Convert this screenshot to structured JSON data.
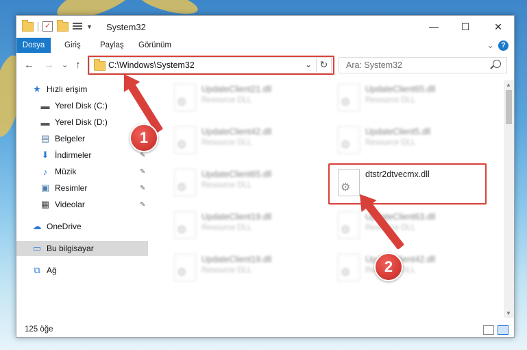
{
  "window": {
    "title": "System32",
    "controls": {
      "minimize": "—",
      "maximize": "☐",
      "close": "✕"
    }
  },
  "ribbon": {
    "tabs": [
      "Dosya",
      "Giriş",
      "Paylaş",
      "Görünüm"
    ],
    "expand_glyph": "⌄",
    "help_label": "?"
  },
  "nav": {
    "back": "←",
    "forward": "→",
    "recent": "⌄",
    "up": "↑",
    "address": "C:\\Windows\\System32",
    "address_dropdown": "⌄",
    "refresh": "↻",
    "search_placeholder": "Ara: System32"
  },
  "sidebar": {
    "items": [
      {
        "label": "Hızlı erişim",
        "icon": "star-icon",
        "glyph": "★",
        "color": "#2a7bd6",
        "pinned": false
      },
      {
        "label": "Yerel Disk (C:)",
        "icon": "drive-icon",
        "glyph": "▬",
        "color": "#555555",
        "pinned": true
      },
      {
        "label": "Yerel Disk (D:)",
        "icon": "drive-icon",
        "glyph": "▬",
        "color": "#555555",
        "pinned": false
      },
      {
        "label": "Belgeler",
        "icon": "document-icon",
        "glyph": "▤",
        "color": "#5b7ea6",
        "pinned": true
      },
      {
        "label": "İndirmeler",
        "icon": "download-icon",
        "glyph": "⬇",
        "color": "#2a7bd6",
        "pinned": true
      },
      {
        "label": "Müzik",
        "icon": "music-icon",
        "glyph": "♪",
        "color": "#2a7bd6",
        "pinned": true
      },
      {
        "label": "Resimler",
        "icon": "picture-icon",
        "glyph": "▣",
        "color": "#4f7fb0",
        "pinned": true
      },
      {
        "label": "Videolar",
        "icon": "video-icon",
        "glyph": "▦",
        "color": "#444444",
        "pinned": true
      },
      {
        "label": "OneDrive",
        "icon": "cloud-icon",
        "glyph": "☁",
        "color": "#2a7bd6",
        "pinned": false
      },
      {
        "label": "Bu bilgisayar",
        "icon": "computer-icon",
        "glyph": "▭",
        "color": "#2a7bd6",
        "pinned": false,
        "selected": true
      },
      {
        "label": "Ağ",
        "icon": "network-icon",
        "glyph": "⧉",
        "color": "#2a7bd6",
        "pinned": false
      }
    ],
    "pin_glyph": "📌"
  },
  "files": [
    {
      "name": "UpdateClient21.dll",
      "type": "Resource DLL",
      "col": 0,
      "row": 0,
      "blurred": true
    },
    {
      "name": "UpdateClient65.dll",
      "type": "Resource DLL",
      "col": 1,
      "row": 0,
      "blurred": true
    },
    {
      "name": "UpdateClient42.dll",
      "type": "Resource DLL",
      "col": 0,
      "row": 1,
      "blurred": true
    },
    {
      "name": "UpdateClient5.dll",
      "type": "Resource DLL",
      "col": 1,
      "row": 1,
      "blurred": true
    },
    {
      "name": "UpdateClient65.dll",
      "type": "Resource DLL",
      "col": 0,
      "row": 2,
      "blurred": true
    },
    {
      "name": "dtstr2dtvecmx.dll",
      "type": "",
      "col": 1,
      "row": 2,
      "blurred": false
    },
    {
      "name": "UpdateClient19.dll",
      "type": "Resource DLL",
      "col": 0,
      "row": 3,
      "blurred": true
    },
    {
      "name": "UpdateClient63.dll",
      "type": "Resource DLL",
      "col": 1,
      "row": 3,
      "blurred": true
    },
    {
      "name": "UpdateClient19.dll",
      "type": "Resource DLL",
      "col": 0,
      "row": 4,
      "blurred": true
    },
    {
      "name": "UpdateClient42.dll",
      "type": "Resource DLL",
      "col": 1,
      "row": 4,
      "blurred": true
    }
  ],
  "status": {
    "count": "125 öğe"
  },
  "annotations": [
    {
      "number": "1",
      "target": "address-bar"
    },
    {
      "number": "2",
      "target": "dll-file"
    }
  ],
  "colors": {
    "accent": "#1979ca",
    "highlight": "#d9403a"
  }
}
